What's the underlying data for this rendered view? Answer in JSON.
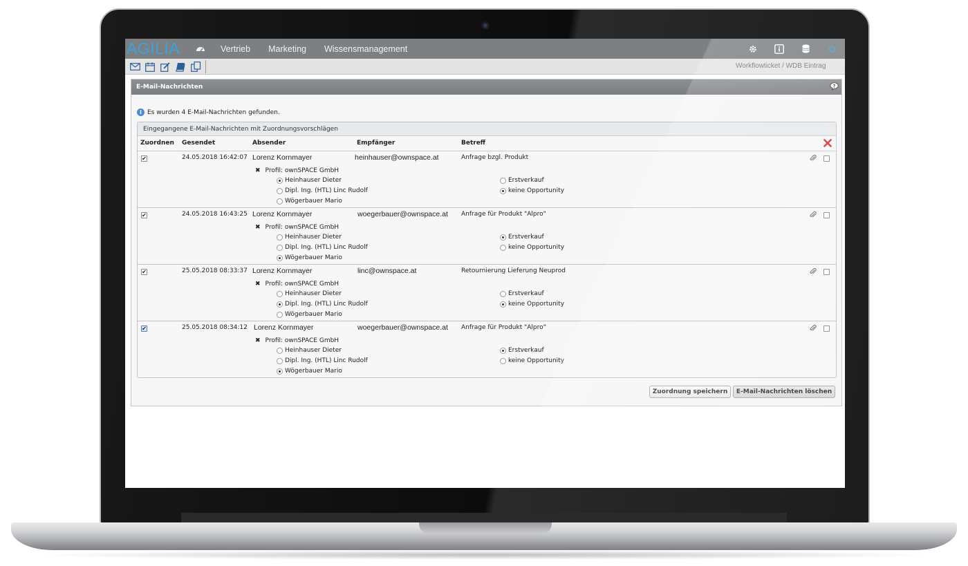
{
  "nav": {
    "logo": "AGILIA",
    "items": [
      "Vertrieb",
      "Marketing",
      "Wissensmanagement"
    ]
  },
  "toolbar": {
    "search_placeholder": "Workflowticket / WDB Eintrag suchen ..."
  },
  "panel": {
    "title": "E-Mail-Nachrichten",
    "info": "Es wurden 4 E-Mail-Nachrichten gefunden.",
    "box_title": "Eingegangene E-Mail-Nachrichten mit Zuordnungsvorschlägen",
    "columns": [
      "Zuordnen",
      "Gesendet",
      "Absender",
      "Empfänger",
      "Betreff"
    ]
  },
  "emails": [
    {
      "assign_checked": true,
      "date": "24.05.2018 16:42:07",
      "sender": "Lorenz Kornmayer",
      "recipient": "heinhauser@ownspace.at",
      "subject": "Anfrage bzgl. Produkt",
      "profile": "Profil: ownSPACE GmbH",
      "persons": [
        {
          "label": "Heinhauser Dieter",
          "selected": true
        },
        {
          "label": "Dipl. Ing. (HTL) Linc Rudolf",
          "selected": false
        },
        {
          "label": "Wögerbauer Mario",
          "selected": false
        }
      ],
      "opportunities": [
        {
          "label": "Erstverkauf",
          "selected": false
        },
        {
          "label": "keine Opportunity",
          "selected": true
        }
      ],
      "delete_checked": false
    },
    {
      "assign_checked": true,
      "date": "24.05.2018 16:43:25",
      "sender": "Lorenz Kornmayer",
      "recipient": "woegerbauer@ownspace.at",
      "subject": "Anfrage für Produkt \"Alpro\"",
      "profile": "Profil: ownSPACE GmbH",
      "persons": [
        {
          "label": "Heinhauser Dieter",
          "selected": false
        },
        {
          "label": "Dipl. Ing. (HTL) Linc Rudolf",
          "selected": false
        },
        {
          "label": "Wögerbauer Mario",
          "selected": true
        }
      ],
      "opportunities": [
        {
          "label": "Erstverkauf",
          "selected": true
        },
        {
          "label": "keine Opportunity",
          "selected": false
        }
      ],
      "delete_checked": false
    },
    {
      "assign_checked": true,
      "date": "25.05.2018 08:33:37",
      "sender": "Lorenz Kornmayer",
      "recipient": "linc@ownspace.at",
      "subject": "Retournierung Lieferung Neuprod",
      "profile": "Profil: ownSPACE GmbH",
      "persons": [
        {
          "label": "Heinhauser Dieter",
          "selected": false
        },
        {
          "label": "Dipl. Ing. (HTL) Linc Rudolf",
          "selected": true
        },
        {
          "label": "Wögerbauer Mario",
          "selected": false
        }
      ],
      "opportunities": [
        {
          "label": "Erstverkauf",
          "selected": false
        },
        {
          "label": "keine Opportunity",
          "selected": true
        }
      ],
      "delete_checked": false
    },
    {
      "assign_checked": true,
      "date": "25.05.2018 08:34:12",
      "sender": "Lorenz Kornmayer",
      "recipient": "woegerbauer@ownspace.at",
      "subject": "Anfrage für Produkt \"Alpro\"",
      "profile": "Profil: ownSPACE GmbH",
      "persons": [
        {
          "label": "Heinhauser Dieter",
          "selected": false
        },
        {
          "label": "Dipl. Ing. (HTL) Linc Rudolf",
          "selected": false
        },
        {
          "label": "Wögerbauer Mario",
          "selected": true
        }
      ],
      "opportunities": [
        {
          "label": "Erstverkauf",
          "selected": true
        },
        {
          "label": "keine Opportunity",
          "selected": false
        }
      ],
      "delete_checked": false
    }
  ],
  "buttons": {
    "save": "Zuordnung speichern",
    "delete": "E-Mail-Nachrichten löschen"
  },
  "colors": {
    "logo": "#3ba3dc",
    "topnav": "#7c8083",
    "panel_header": "#7a7d80",
    "delete_red": "#d9312b"
  },
  "icons": [
    "dashboard-icon",
    "settings-icon",
    "info-icon",
    "database-icon",
    "power-icon",
    "mail-icon",
    "calendar-icon",
    "edit-icon",
    "book-icon",
    "copy-icon",
    "help-icon",
    "delete-icon",
    "paperclip-icon"
  ]
}
